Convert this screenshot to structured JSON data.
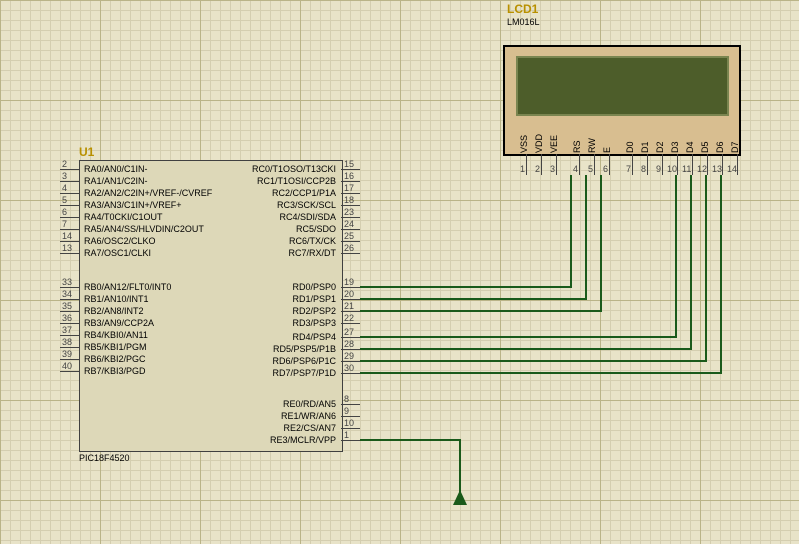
{
  "chip": {
    "ref": "U1",
    "part": "PIC18F4520",
    "left_pins": [
      {
        "num": "2",
        "name": "RA0/AN0/C1IN-"
      },
      {
        "num": "3",
        "name": "RA1/AN1/C2IN-"
      },
      {
        "num": "4",
        "name": "RA2/AN2/C2IN+/VREF-/CVREF"
      },
      {
        "num": "5",
        "name": "RA3/AN3/C1IN+/VREF+"
      },
      {
        "num": "6",
        "name": "RA4/T0CKI/C1OUT"
      },
      {
        "num": "7",
        "name": "RA5/AN4/SS/HLVDIN/C2OUT"
      },
      {
        "num": "14",
        "name": "RA6/OSC2/CLKO"
      },
      {
        "num": "13",
        "name": "RA7/OSC1/CLKI"
      },
      {
        "num": "33",
        "name": "RB0/AN12/FLT0/INT0"
      },
      {
        "num": "34",
        "name": "RB1/AN10/INT1"
      },
      {
        "num": "35",
        "name": "RB2/AN8/INT2"
      },
      {
        "num": "36",
        "name": "RB3/AN9/CCP2A"
      },
      {
        "num": "37",
        "name": "RB4/KBI0/AN11"
      },
      {
        "num": "38",
        "name": "RB5/KBI1/PGM"
      },
      {
        "num": "39",
        "name": "RB6/KBI2/PGC"
      },
      {
        "num": "40",
        "name": "RB7/KBI3/PGD"
      }
    ],
    "right_pins": [
      {
        "num": "15",
        "name": "RC0/T1OSO/T13CKI"
      },
      {
        "num": "16",
        "name": "RC1/T1OSI/CCP2B"
      },
      {
        "num": "17",
        "name": "RC2/CCP1/P1A"
      },
      {
        "num": "18",
        "name": "RC3/SCK/SCL"
      },
      {
        "num": "23",
        "name": "RC4/SDI/SDA"
      },
      {
        "num": "24",
        "name": "RC5/SDO"
      },
      {
        "num": "25",
        "name": "RC6/TX/CK"
      },
      {
        "num": "26",
        "name": "RC7/RX/DT"
      },
      {
        "num": "19",
        "name": "RD0/PSP0"
      },
      {
        "num": "20",
        "name": "RD1/PSP1"
      },
      {
        "num": "21",
        "name": "RD2/PSP2"
      },
      {
        "num": "22",
        "name": "RD3/PSP3"
      },
      {
        "num": "27",
        "name": "RD4/PSP4"
      },
      {
        "num": "28",
        "name": "RD5/PSP5/P1B"
      },
      {
        "num": "29",
        "name": "RD6/PSP6/P1C"
      },
      {
        "num": "30",
        "name": "RD7/PSP7/P1D"
      },
      {
        "num": "8",
        "name": "RE0/RD/AN5"
      },
      {
        "num": "9",
        "name": "RE1/WR/AN6"
      },
      {
        "num": "10",
        "name": "RE2/CS/AN7"
      },
      {
        "num": "1",
        "name": "RE3/MCLR/VPP"
      }
    ]
  },
  "lcd": {
    "ref": "LCD1",
    "part": "LM016L",
    "pins": [
      "VSS",
      "VDD",
      "VEE",
      "RS",
      "RW",
      "E",
      "D0",
      "D1",
      "D2",
      "D3",
      "D4",
      "D5",
      "D6",
      "D7"
    ],
    "pin_nums": [
      "1",
      "2",
      "3",
      "4",
      "5",
      "6",
      "7",
      "8",
      "9",
      "10",
      "11",
      "12",
      "13",
      "14"
    ]
  }
}
